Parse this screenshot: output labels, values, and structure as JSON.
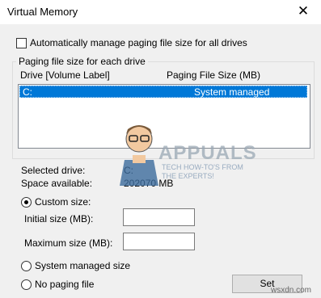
{
  "window": {
    "title": "Virtual Memory"
  },
  "auto_manage": {
    "label": "Automatically manage paging file size for all drives",
    "checked": false
  },
  "group": {
    "label": "Paging file size for each drive"
  },
  "table": {
    "headers": [
      "Drive  [Volume Label]",
      "Paging File Size (MB)"
    ],
    "rows": [
      {
        "drive": "C:",
        "size": "System managed",
        "selected": true
      }
    ]
  },
  "selected_drive": {
    "label": "Selected drive:",
    "value": "C:"
  },
  "space_available": {
    "label": "Space available:",
    "value": "202070 MB"
  },
  "options": {
    "custom": {
      "label": "Custom size:",
      "checked": true
    },
    "initial": {
      "label": "Initial size (MB):",
      "value": ""
    },
    "maximum": {
      "label": "Maximum size (MB):",
      "value": ""
    },
    "system_managed": {
      "label": "System managed size",
      "checked": false
    },
    "no_paging": {
      "label": "No paging file",
      "checked": false
    }
  },
  "buttons": {
    "set": "Set"
  },
  "watermark": {
    "brand": "APPUALS",
    "tagline1": "TECH HOW-TO'S FROM",
    "tagline2": "THE EXPERTS!",
    "site": "wsxdn.com"
  }
}
